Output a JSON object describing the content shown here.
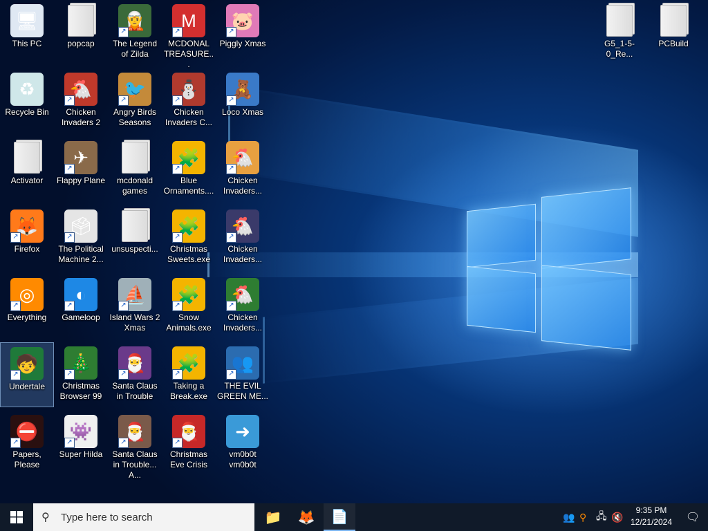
{
  "desktop": {
    "icons": [
      {
        "label": "This PC",
        "glyph": "🖥",
        "shortcut": false,
        "bg": "#dfe8f3"
      },
      {
        "label": "Recycle Bin",
        "glyph": "♻",
        "shortcut": false,
        "bg": "#cfe7e9"
      },
      {
        "label": "Activator",
        "glyph": "",
        "shortcut": false,
        "folder": true
      },
      {
        "label": "Firefox",
        "glyph": "🦊",
        "shortcut": true,
        "bg": "#ff7a1a"
      },
      {
        "label": "Everything",
        "glyph": "◎",
        "shortcut": true,
        "bg": "#ff8a00"
      },
      {
        "label": "Undertale",
        "glyph": "🧒",
        "shortcut": true,
        "bg": "#1f7a3a"
      },
      {
        "label": "Papers, Please",
        "glyph": "⛔",
        "shortcut": true,
        "bg": "#2a1010"
      },
      {
        "label": "popcap",
        "glyph": "",
        "shortcut": false,
        "folder": true
      },
      {
        "label": "Chicken Invaders 2",
        "glyph": "🐔",
        "shortcut": true,
        "bg": "#c0392b"
      },
      {
        "label": "Flappy Plane",
        "glyph": "✈",
        "shortcut": true,
        "bg": "#8a6a4a"
      },
      {
        "label": "The Political Machine 2...",
        "glyph": "🗳",
        "shortcut": true,
        "bg": "#e5e5e5"
      },
      {
        "label": "Gameloop",
        "glyph": "◐",
        "shortcut": true,
        "bg": "#1e88e5"
      },
      {
        "label": "Christmas Browser 99",
        "glyph": "🎄",
        "shortcut": true,
        "bg": "#2e7d32"
      },
      {
        "label": "Super Hilda",
        "glyph": "👾",
        "shortcut": true,
        "bg": "#f0f0f0"
      },
      {
        "label": "The Legend of Zilda",
        "glyph": "🧝",
        "shortcut": true,
        "bg": "#3a6a3a"
      },
      {
        "label": "Angry Birds Seasons",
        "glyph": "🐦",
        "shortcut": true,
        "bg": "#c48a3a"
      },
      {
        "label": "mcdonald games",
        "glyph": "",
        "shortcut": false,
        "folder": true
      },
      {
        "label": "unsuspecti...",
        "glyph": "",
        "shortcut": false,
        "folder": true
      },
      {
        "label": "Island Wars 2 Xmas",
        "glyph": "⛵",
        "shortcut": true,
        "bg": "#9fb0b8"
      },
      {
        "label": "Santa Claus in Trouble",
        "glyph": "🎅",
        "shortcut": true,
        "bg": "#6a3a8a"
      },
      {
        "label": "Santa Claus in Trouble... A...",
        "glyph": "🎅",
        "shortcut": true,
        "bg": "#7a5a4a"
      },
      {
        "label": "MCDONAL TREASURE...",
        "glyph": "M",
        "shortcut": true,
        "bg": "#d32f2f"
      },
      {
        "label": "Chicken Invaders C...",
        "glyph": "⛄",
        "shortcut": true,
        "bg": "#b03a2e"
      },
      {
        "label": "Blue Ornaments....",
        "glyph": "🧩",
        "shortcut": true,
        "bg": "#f4b400"
      },
      {
        "label": "Christmas Sweets.exe",
        "glyph": "🧩",
        "shortcut": true,
        "bg": "#f4b400"
      },
      {
        "label": "Snow Animals.exe",
        "glyph": "🧩",
        "shortcut": true,
        "bg": "#f4b400"
      },
      {
        "label": "Taking a Break.exe",
        "glyph": "🧩",
        "shortcut": true,
        "bg": "#f4b400"
      },
      {
        "label": "Christmas Eve Crisis",
        "glyph": "🎅",
        "shortcut": true,
        "bg": "#c62828"
      },
      {
        "label": "Piggly Xmas",
        "glyph": "🐷",
        "shortcut": true,
        "bg": "#e07ab8"
      },
      {
        "label": "Loco Xmas",
        "glyph": "🧸",
        "shortcut": true,
        "bg": "#3a7ac8"
      },
      {
        "label": "Chicken Invaders...",
        "glyph": "🐔",
        "shortcut": true,
        "bg": "#e8a040"
      },
      {
        "label": "Chicken Invaders...",
        "glyph": "🐔",
        "shortcut": true,
        "bg": "#3a3a6a"
      },
      {
        "label": "Chicken Invaders...",
        "glyph": "🐔",
        "shortcut": true,
        "bg": "#2e7d32"
      },
      {
        "label": "THE EVIL GREEN ME...",
        "glyph": "👥",
        "shortcut": true,
        "bg": "#2b6cb0"
      },
      {
        "label": "vm0b0t vm0b0t",
        "glyph": "➜",
        "shortcut": false,
        "bg": "#3a9ad8"
      },
      {
        "label": "G5_1-5-0_Re...",
        "glyph": "",
        "shortcut": false,
        "folder": true
      },
      {
        "label": "PCBuild",
        "glyph": "",
        "shortcut": false,
        "folder": true
      }
    ]
  },
  "taskbar": {
    "search_placeholder": "Type here to search",
    "apps": [
      {
        "name": "File Explorer",
        "glyph": "📁"
      },
      {
        "name": "Firefox",
        "glyph": "🦊"
      },
      {
        "name": "Notepad-like App",
        "glyph": "📄"
      }
    ],
    "time": "9:35 PM",
    "date": "12/21/2024"
  }
}
